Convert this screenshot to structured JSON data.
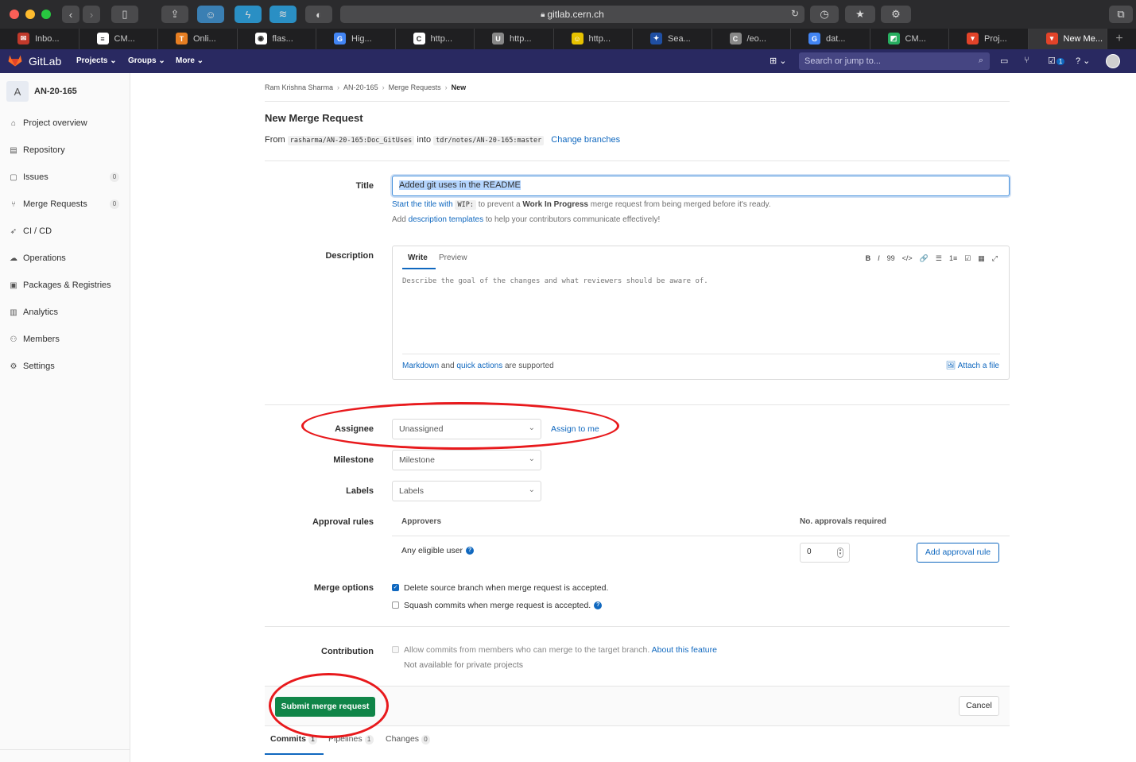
{
  "browser": {
    "url": "gitlab.cern.ch",
    "tabs": [
      {
        "label": "Inbo...",
        "icon": "mail-icon",
        "color": "#c0392b"
      },
      {
        "label": "CM...",
        "icon": "document-icon",
        "color": "#ffffff"
      },
      {
        "label": "Onli...",
        "icon": "t-icon",
        "color": "#e67e22"
      },
      {
        "label": "flas...",
        "icon": "github-icon",
        "color": "#ffffff"
      },
      {
        "label": "Hig...",
        "icon": "google-icon",
        "color": "#4285f4"
      },
      {
        "label": "http...",
        "icon": "cds-icon",
        "color": "#ffffff"
      },
      {
        "label": "http...",
        "icon": "u-icon",
        "color": "#888888"
      },
      {
        "label": "http...",
        "icon": "smiley-icon",
        "color": "#e6c200"
      },
      {
        "label": "Sea...",
        "icon": "eu-icon",
        "color": "#1f4fa3"
      },
      {
        "label": "/eo...",
        "icon": "c-icon",
        "color": "#888888"
      },
      {
        "label": "dat...",
        "icon": "google-icon",
        "color": "#4285f4"
      },
      {
        "label": "CM...",
        "icon": "cm-icon",
        "color": "#27ae60"
      },
      {
        "label": "Proj...",
        "icon": "gitlab-icon",
        "color": "#e24329"
      },
      {
        "label": "New Me...",
        "icon": "gitlab-icon",
        "color": "#e24329"
      }
    ]
  },
  "gitlab_nav": {
    "brand": "GitLab",
    "menus": [
      "Projects",
      "Groups",
      "More"
    ],
    "search_placeholder": "Search or jump to...",
    "todo_count": "1"
  },
  "sidebar": {
    "project_initial": "A",
    "project_name": "AN-20-165",
    "items": [
      {
        "label": "Project overview",
        "icon": "home-icon"
      },
      {
        "label": "Repository",
        "icon": "book-icon"
      },
      {
        "label": "Issues",
        "icon": "issues-icon",
        "badge": "0"
      },
      {
        "label": "Merge Requests",
        "icon": "merge-request-icon",
        "badge": "0"
      },
      {
        "label": "CI / CD",
        "icon": "rocket-icon"
      },
      {
        "label": "Operations",
        "icon": "cloud-icon"
      },
      {
        "label": "Packages & Registries",
        "icon": "package-icon"
      },
      {
        "label": "Analytics",
        "icon": "chart-icon"
      },
      {
        "label": "Members",
        "icon": "users-icon"
      },
      {
        "label": "Settings",
        "icon": "gear-icon"
      }
    ]
  },
  "breadcrumbs": [
    "Ram Krishna Sharma",
    "AN-20-165",
    "Merge Requests",
    "New"
  ],
  "page": {
    "title": "New Merge Request",
    "from_label": "From",
    "source_branch": "rasharma/AN-20-165:Doc_GitUses",
    "into_label": "into",
    "target_branch": "tdr/notes/AN-20-165:master",
    "change_branches": "Change branches"
  },
  "form": {
    "title_label": "Title",
    "title_value": "Added git uses in the README",
    "wip_help_link": "Start the title with",
    "wip_code": "WIP:",
    "wip_help_rest": "to prevent a",
    "wip_bold": "Work In Progress",
    "wip_help_end": "merge request from being merged before it's ready.",
    "templates_pre": "Add",
    "templates_link": "description templates",
    "templates_post": "to help your contributors communicate effectively!",
    "description_label": "Description",
    "tab_write": "Write",
    "tab_preview": "Preview",
    "toolbar_tools": [
      "B",
      "I",
      "99",
      "</>",
      "🔗",
      "☰",
      "1≡",
      "☑",
      "▦",
      "⤢"
    ],
    "description_placeholder": "Describe the goal of the changes and what reviewers should be aware of.",
    "md_link": "Markdown",
    "md_and": "and",
    "qa_link": "quick actions",
    "md_supported": "are supported",
    "attach_file": "Attach a file",
    "assignee_label": "Assignee",
    "assignee_value": "Unassigned",
    "assign_to_me": "Assign to me",
    "milestone_label": "Milestone",
    "milestone_value": "Milestone",
    "labels_label": "Labels",
    "labels_value": "Labels",
    "approval_label": "Approval rules",
    "approvers_header": "Approvers",
    "approvals_required_header": "No. approvals required",
    "any_eligible_user": "Any eligible user",
    "approvals_value": "0",
    "add_approval_rule": "Add approval rule",
    "merge_options_label": "Merge options",
    "delete_source_branch": "Delete source branch when merge request is accepted.",
    "delete_source_checked": true,
    "squash_commits": "Squash commits when merge request is accepted.",
    "squash_checked": false,
    "contribution_label": "Contribution",
    "allow_commits": "Allow commits from members who can merge to the target branch.",
    "about_feature": "About this feature",
    "not_available": "Not available for private projects",
    "submit": "Submit merge request",
    "cancel": "Cancel"
  },
  "bottom_tabs": [
    {
      "label": "Commits",
      "count": "1"
    },
    {
      "label": "Pipelines",
      "count": "1"
    },
    {
      "label": "Changes",
      "count": "0"
    }
  ],
  "colors": {
    "nav_bg": "#292961",
    "link": "#1068bf",
    "submit_green": "#108548",
    "annotation_red": "#e8191c"
  }
}
